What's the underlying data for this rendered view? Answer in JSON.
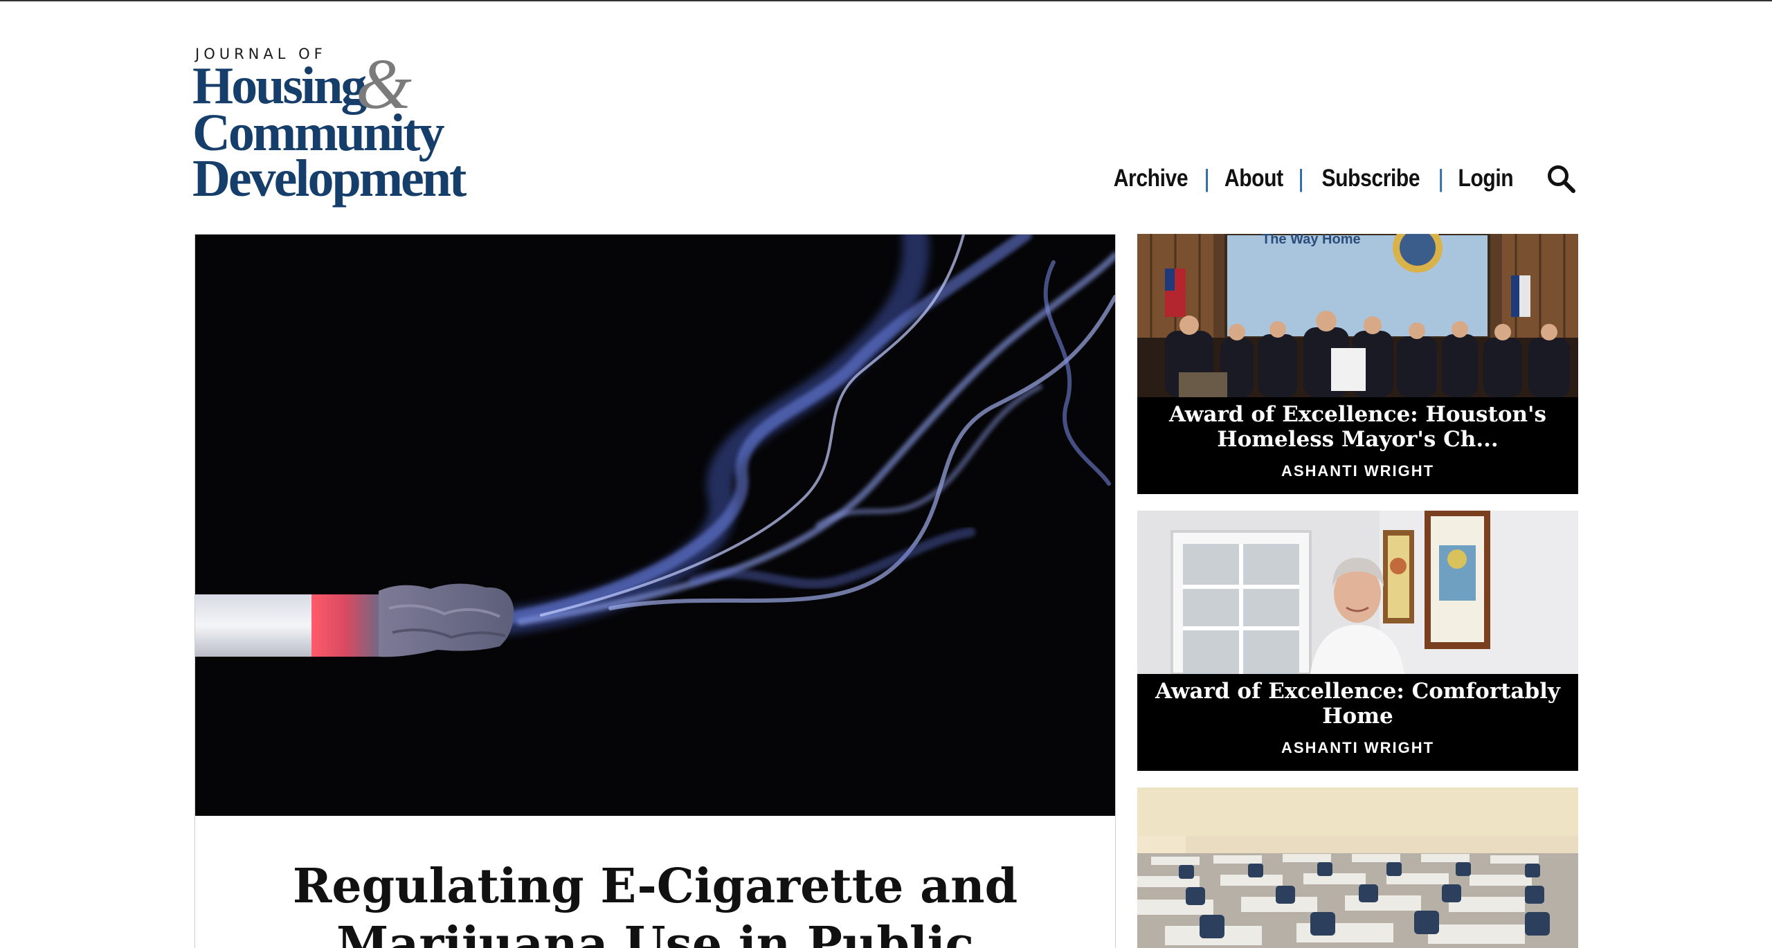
{
  "site": {
    "logo_journal_of": "JOURNAL OF",
    "logo_line1": "Housing",
    "logo_ampersand": "&",
    "logo_line2": "Community",
    "logo_line3": "Development"
  },
  "nav": {
    "items": [
      {
        "label": "Archive"
      },
      {
        "label": "About"
      },
      {
        "label": "Subscribe"
      },
      {
        "label": "Login"
      }
    ],
    "separator": "|",
    "search_icon": "search-icon"
  },
  "featured": {
    "title": "Regulating E-Cigarette and Marijuana Use in Public",
    "image": "cigarette-smoke-photo"
  },
  "side_articles": [
    {
      "title": "Award of Excellence: Houston's Homeless Mayor's Ch...",
      "author": "ASHANTI WRIGHT",
      "image": "award-ceremony-photo"
    },
    {
      "title": "Award of Excellence: Comfortably Home",
      "author": "ASHANTI WRIGHT",
      "image": "woman-portrait-photo"
    },
    {
      "title": "",
      "author": "",
      "image": "classroom-desks-photo"
    }
  ],
  "colors": {
    "brand_blue": "#163e6b",
    "nav_separator": "#2e6da4",
    "card_background": "#000000"
  }
}
